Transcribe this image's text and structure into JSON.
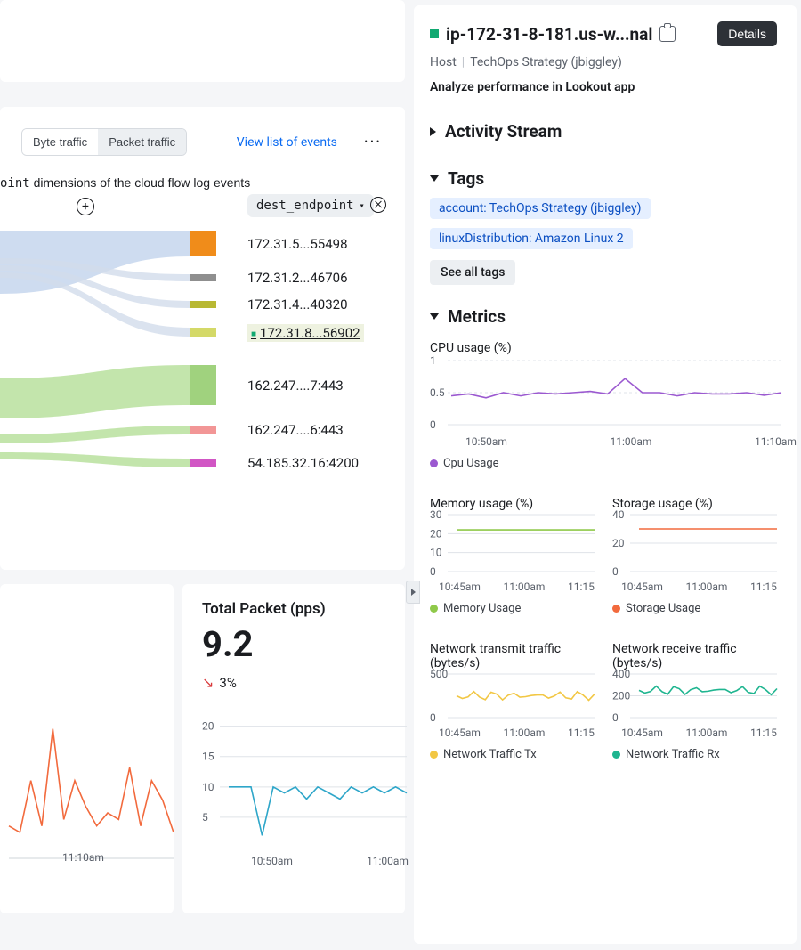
{
  "left": {
    "toggle": {
      "byte": "Byte traffic",
      "packet": "Packet traffic"
    },
    "view_list": "View list of events",
    "dim_text_mono": "oint",
    "dim_text_rest": " dimensions of the cloud flow log events",
    "dim_pill": "dest_endpoint",
    "endpoints": [
      {
        "label": "172.31.5...55498",
        "color": "#f08c1a",
        "height": 28,
        "sel": false
      },
      {
        "label": "172.31.2...46706",
        "color": "#8f8f8f",
        "height": 8,
        "sel": false
      },
      {
        "label": "172.31.4...40320",
        "color": "#b8b833",
        "height": 8,
        "sel": false
      },
      {
        "label": "172.31.8...56902",
        "color": "#d4d968",
        "height": 10,
        "sel": true
      },
      {
        "label": "162.247....7:443",
        "color": "#a0d27e",
        "height": 45,
        "sel": false
      },
      {
        "label": "162.247....6:443",
        "color": "#f29696",
        "height": 10,
        "sel": false
      },
      {
        "label": "54.185.32.16:4200",
        "color": "#d156c4",
        "height": 10,
        "sel": false
      }
    ]
  },
  "packet": {
    "title": "Total Packet (pps)",
    "value": "9.2",
    "delta": "3%"
  },
  "packet_chart": {
    "y_ticks": [
      "20",
      "15",
      "10",
      "5"
    ],
    "x_ticks": [
      "10:50am",
      "11:00am"
    ],
    "color": "#2ea6c9",
    "points": [
      10,
      10,
      10,
      2,
      10,
      9,
      10,
      8,
      10,
      9,
      8,
      10,
      9,
      10,
      9,
      10,
      9
    ]
  },
  "left_chart": {
    "x_tick": "11:10am",
    "color": "#f26a3d",
    "points": [
      5,
      4,
      12,
      5,
      20,
      6,
      12,
      8,
      5,
      7,
      6,
      14,
      5,
      12,
      9,
      4
    ]
  },
  "right": {
    "host": "ip-172-31-8-181.us-w...nal",
    "details": "Details",
    "bc1": "Host",
    "bc2": "TechOps Strategy (jbiggley)",
    "analyze": "Analyze performance in Lookout app",
    "activity": "Activity Stream",
    "tags_h": "Tags",
    "tags": [
      "account: TechOps Strategy (jbiggley)",
      "linuxDistribution: Amazon Linux 2"
    ],
    "see_all": "See all tags",
    "metrics_h": "Metrics"
  },
  "metrics": {
    "cpu": {
      "title": "CPU usage (%)",
      "y_ticks": [
        "1",
        "0.5",
        "0"
      ],
      "x_ticks": [
        "10:50am",
        "11:00am",
        "11:10am"
      ],
      "legend": "Cpu Usage",
      "color": "#9b59d0",
      "points": [
        0.45,
        0.48,
        0.42,
        0.5,
        0.45,
        0.5,
        0.48,
        0.5,
        0.52,
        0.48,
        0.72,
        0.5,
        0.5,
        0.45,
        0.5,
        0.48,
        0.48,
        0.5,
        0.46,
        0.5
      ]
    },
    "memory": {
      "title": "Memory usage (%)",
      "y_ticks": [
        "30",
        "20",
        "10",
        "0"
      ],
      "x_ticks": [
        "10:45am",
        "11:00am",
        "11:15"
      ],
      "legend": "Memory Usage",
      "color": "#8fc94a",
      "value": 22
    },
    "storage": {
      "title": "Storage usage (%)",
      "y_ticks": [
        "40",
        "20",
        "0"
      ],
      "x_ticks": [
        "10:45am",
        "11:00am",
        "11:15"
      ],
      "legend": "Storage Usage",
      "color": "#f26a3d",
      "value": 30
    },
    "tx": {
      "title": "Network transmit traffic (bytes/s)",
      "y_ticks": [
        "500",
        "0"
      ],
      "x_ticks": [
        "10:45am",
        "11:00am",
        "11:15"
      ],
      "legend": "Network Traffic Tx",
      "color": "#f2c744",
      "value": 250
    },
    "rx": {
      "title": "Network receive traffic (bytes/s)",
      "y_ticks": [
        "400",
        "200",
        "0"
      ],
      "x_ticks": [
        "10:45am",
        "11:00am",
        "11:15"
      ],
      "legend": "Network Traffic Rx",
      "color": "#1fb590",
      "value": 250
    }
  },
  "chart_data": [
    {
      "type": "bar",
      "title": "Total Packet (pps)",
      "value": 9.2,
      "delta_pct": -3,
      "series": [
        {
          "name": "pps",
          "values": [
            10,
            10,
            10,
            2,
            10,
            9,
            10,
            8,
            10,
            9,
            8,
            10,
            9,
            10,
            9,
            10,
            9
          ]
        }
      ],
      "x_ticks": [
        "10:50am",
        "11:00am"
      ],
      "ylim": [
        0,
        20
      ]
    },
    {
      "type": "line",
      "title": "CPU usage (%)",
      "series": [
        {
          "name": "Cpu Usage",
          "values": [
            0.45,
            0.48,
            0.42,
            0.5,
            0.45,
            0.5,
            0.48,
            0.5,
            0.52,
            0.48,
            0.72,
            0.5,
            0.5,
            0.45,
            0.5,
            0.48,
            0.48,
            0.5,
            0.46,
            0.5
          ]
        }
      ],
      "x_ticks": [
        "10:50am",
        "11:00am",
        "11:10am"
      ],
      "ylim": [
        0,
        1
      ]
    },
    {
      "type": "line",
      "title": "Memory usage (%)",
      "series": [
        {
          "name": "Memory Usage",
          "values": [
            22
          ]
        }
      ],
      "x_ticks": [
        "10:45am",
        "11:00am",
        "11:15"
      ],
      "ylim": [
        0,
        30
      ]
    },
    {
      "type": "line",
      "title": "Storage usage (%)",
      "series": [
        {
          "name": "Storage Usage",
          "values": [
            30
          ]
        }
      ],
      "x_ticks": [
        "10:45am",
        "11:00am",
        "11:15"
      ],
      "ylim": [
        0,
        40
      ]
    },
    {
      "type": "line",
      "title": "Network transmit traffic (bytes/s)",
      "series": [
        {
          "name": "Network Traffic Tx",
          "values": [
            250
          ]
        }
      ],
      "x_ticks": [
        "10:45am",
        "11:00am",
        "11:15"
      ],
      "ylim": [
        0,
        500
      ]
    },
    {
      "type": "line",
      "title": "Network receive traffic (bytes/s)",
      "series": [
        {
          "name": "Network Traffic Rx",
          "values": [
            250
          ]
        }
      ],
      "x_ticks": [
        "10:45am",
        "11:00am",
        "11:15"
      ],
      "ylim": [
        0,
        400
      ]
    }
  ]
}
